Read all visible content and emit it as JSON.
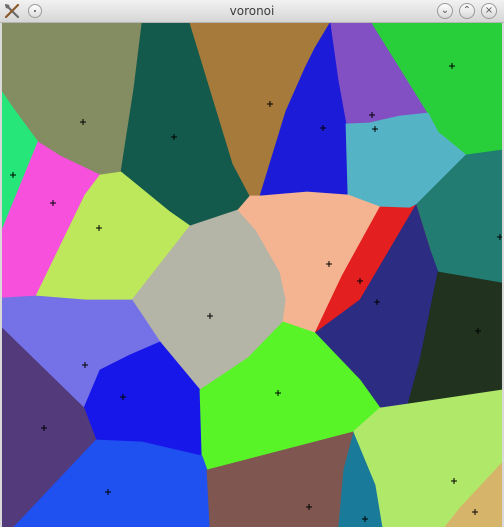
{
  "window": {
    "title": "voronoi",
    "app_icon": "tools-icon",
    "buttons": {
      "menu": "circle-menu-icon",
      "minimize": "chevron-down-icon",
      "maximize": "chevron-up-icon",
      "close": "close-icon"
    },
    "glyphs": {
      "minimize": "⌄",
      "maximize": "⌃",
      "close": "×"
    }
  },
  "voronoi": {
    "site_marker": "+",
    "cells": [
      {
        "color": "#848c62"
      },
      {
        "color": "#145a4c"
      },
      {
        "color": "#a67a3a"
      },
      {
        "color": "#8350c4"
      },
      {
        "color": "#28cf3a"
      },
      {
        "color": "#26e67a"
      },
      {
        "color": "#1c1cd8"
      },
      {
        "color": "#55b3c6"
      },
      {
        "color": "#f750dc"
      },
      {
        "color": "#bde85c"
      },
      {
        "color": "#227c72"
      },
      {
        "color": "#b4b4a7"
      },
      {
        "color": "#f4b491"
      },
      {
        "color": "#e41f1f"
      },
      {
        "color": "#2c2c82"
      },
      {
        "color": "#7472e6"
      },
      {
        "color": "#21331f"
      },
      {
        "color": "#1717e9"
      },
      {
        "color": "#58f428"
      },
      {
        "color": "#533a7a"
      },
      {
        "color": "#1f50f0"
      },
      {
        "color": "#b0e86a"
      },
      {
        "color": "#1a7a9a"
      },
      {
        "color": "#805650"
      },
      {
        "color": "#d6b46a"
      }
    ]
  }
}
